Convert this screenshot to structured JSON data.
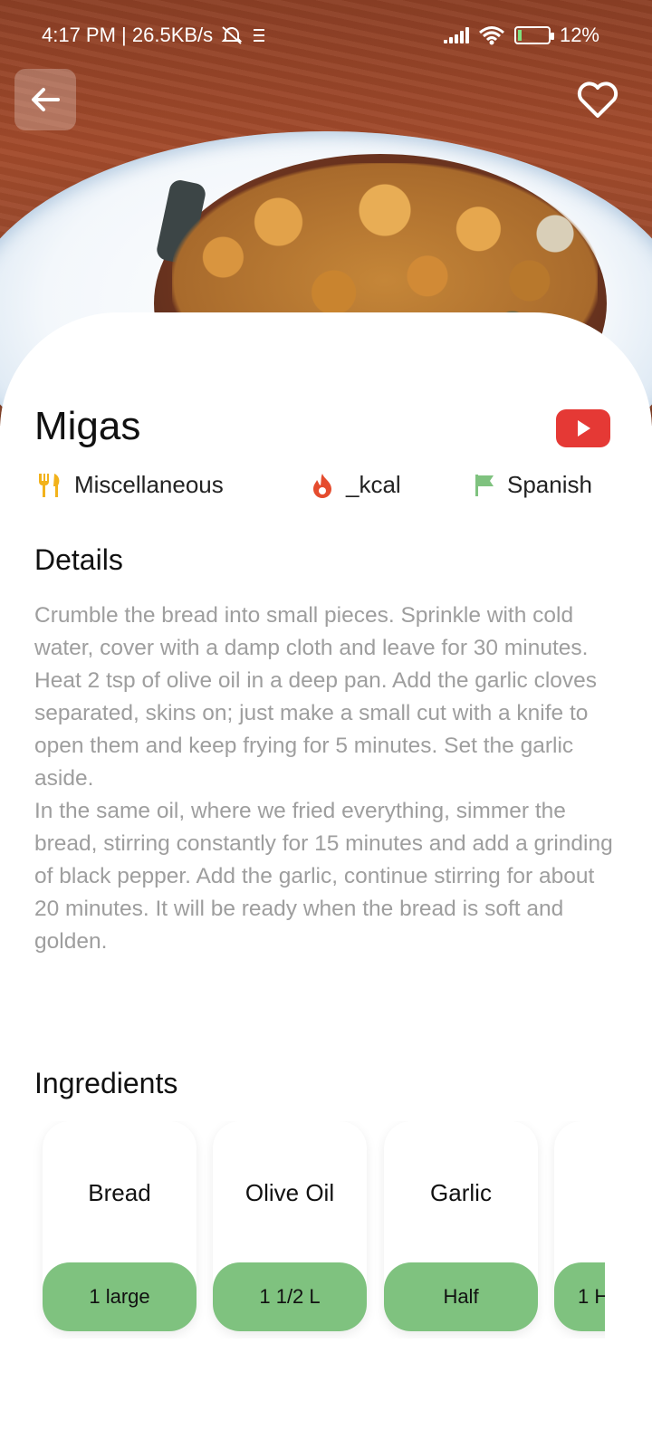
{
  "status_bar": {
    "time_and_speed": "4:17 PM | 26.5KB/s",
    "battery_text": "12%"
  },
  "recipe": {
    "title": "Migas",
    "category": "Miscellaneous",
    "calories": "_kcal",
    "area": "Spanish"
  },
  "sections": {
    "details_label": "Details",
    "ingredients_label": "Ingredients"
  },
  "details_text": "Crumble the bread into small pieces. Sprinkle with cold water, cover with a damp cloth and leave for 30 minutes.\nHeat 2 tsp of olive oil in a deep pan. Add the garlic cloves separated, skins on; just make a small cut with a knife to open them and keep frying for 5 minutes. Set the garlic aside.\nIn the same oil, where we fried everything, simmer the bread, stirring constantly for 15 minutes and add a grinding of black pepper. Add the garlic, continue stirring for about 20 minutes. It will be ready when the bread is soft and golden.",
  "ingredients": [
    {
      "name": "Bread",
      "measure": "1 large"
    },
    {
      "name": "Olive Oil",
      "measure": "1 1/2 L"
    },
    {
      "name": "Garlic",
      "measure": "Half"
    },
    {
      "name": "",
      "measure": "1 H"
    }
  ],
  "icons": {
    "back": "arrow-left-icon",
    "favorite": "heart-outline-icon",
    "youtube": "youtube-play-icon",
    "category": "fork-knife-icon",
    "calories": "flame-icon",
    "area": "flag-icon"
  },
  "colors": {
    "accent_green": "#7fc27f",
    "youtube_red": "#e53935",
    "fork_icon": "#f2b21b",
    "flame_icon": "#e54c2e",
    "flag_icon": "#7fc27f",
    "body_text": "#9e9e9e"
  }
}
